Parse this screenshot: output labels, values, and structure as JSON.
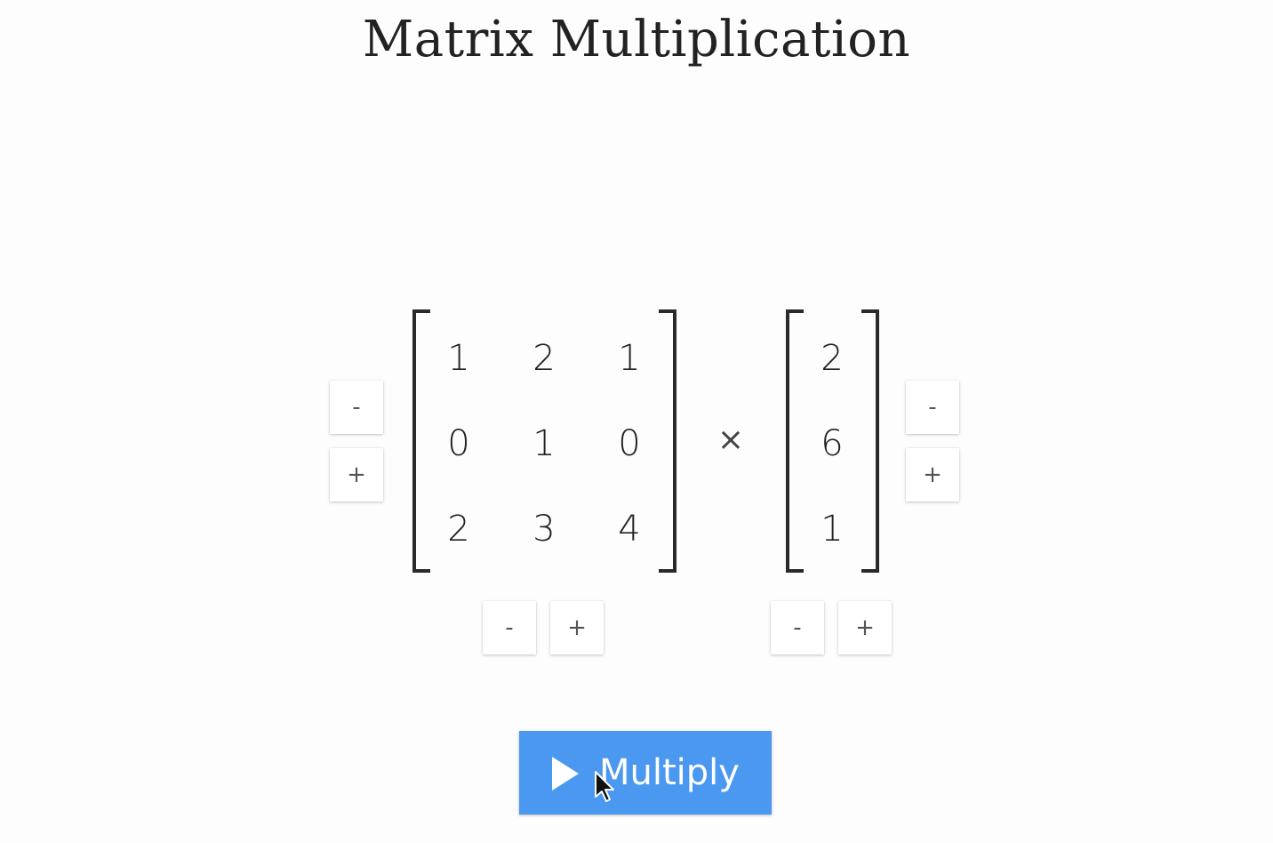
{
  "title": "Matrix Multiplication",
  "matrix_a": [
    [
      "1",
      "2",
      "1"
    ],
    [
      "0",
      "1",
      "0"
    ],
    [
      "2",
      "3",
      "4"
    ]
  ],
  "matrix_b": [
    [
      "2"
    ],
    [
      "6"
    ],
    [
      "1"
    ]
  ],
  "operator": "×",
  "controls": {
    "minus_label": "-",
    "plus_label": "+"
  },
  "multiply_button": {
    "label": "Multiply",
    "icon": "play-icon",
    "color": "#4b98f0"
  },
  "cursor_icon": "mouse-pointer-icon"
}
